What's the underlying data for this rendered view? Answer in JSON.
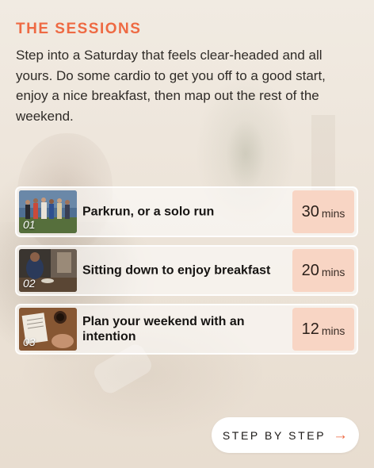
{
  "heading": "THE SESSIONS",
  "intro": "Step into a Saturday that feels clear-headed and all yours. Do some cardio to get you off to a good start, enjoy a nice breakfast, then map out the rest of the weekend.",
  "sessions": [
    {
      "number": "01",
      "title": "Parkrun, or a solo run",
      "duration": "30",
      "unit": "mins"
    },
    {
      "number": "02",
      "title": "Sitting down to enjoy breakfast",
      "duration": "20",
      "unit": "mins"
    },
    {
      "number": "03",
      "title": "Plan your weekend with an intention",
      "duration": "12",
      "unit": "mins"
    }
  ],
  "cta": {
    "label": "STEP BY STEP",
    "arrow": "→"
  },
  "colors": {
    "accent": "#ee6a43",
    "duration_bg": "#f8d5c4"
  }
}
